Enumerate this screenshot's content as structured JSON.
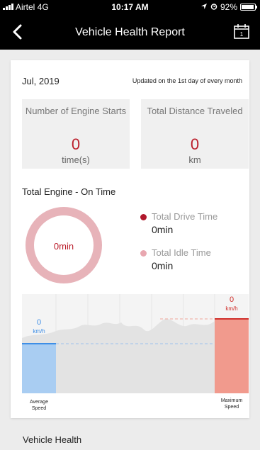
{
  "status_bar": {
    "carrier": "Airtel 4G",
    "time": "10:17 AM",
    "battery": "92%",
    "icons": [
      "signal-icon",
      "location-arrow-icon",
      "alarm-icon",
      "battery-icon"
    ]
  },
  "header": {
    "title": "Vehicle Health Report",
    "icons": [
      "back-chevron-icon",
      "calendar-icon"
    ]
  },
  "report": {
    "month": "Jul, 2019",
    "updated_note": "Updated on the 1st day of every month",
    "engine_starts": {
      "label": "Number of Engine Starts",
      "value": "0",
      "unit": "time(s)"
    },
    "total_distance": {
      "label": "Total Distance Traveled",
      "value": "0",
      "unit": "km"
    }
  },
  "engine_on_time": {
    "title": "Total Engine - On Time",
    "donut_value": "0min",
    "drive": {
      "label": "Total Drive Time",
      "value": "0min"
    },
    "idle": {
      "label": "Total Idle Time",
      "value": "0min"
    }
  },
  "speed": {
    "average": {
      "value": "0",
      "unit": "km/h",
      "label": "Average Speed"
    },
    "maximum": {
      "value": "0",
      "unit": "km/h",
      "label": "Maximum Speed"
    }
  },
  "sections": {
    "vehicle_health": "Vehicle Health"
  },
  "colors": {
    "accent_red": "#bb1f2c",
    "drive_dot": "#b0182c",
    "idle_dot": "#e8a7b0",
    "donut_ring": "#e7b3b9",
    "average_blue": "#3e8ee6",
    "maximum_red": "#d0312d"
  }
}
